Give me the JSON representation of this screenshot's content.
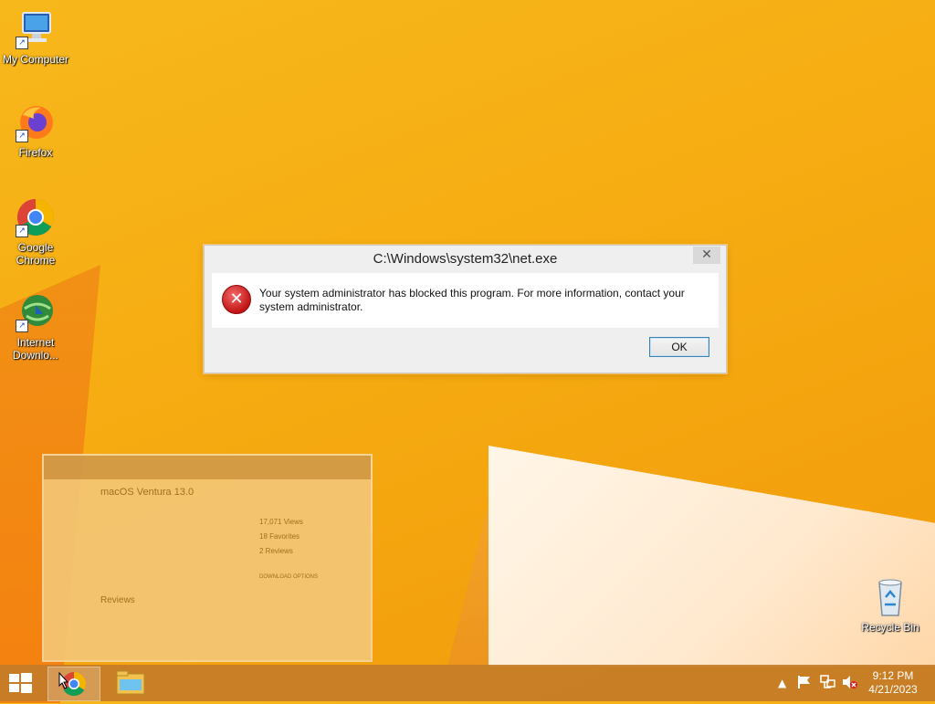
{
  "desktop": {
    "icons": [
      {
        "label": "My Computer"
      },
      {
        "label": "Firefox"
      },
      {
        "label": "Google Chrome"
      },
      {
        "label": "Internet Downlo..."
      },
      {
        "label": "Recycle Bin"
      }
    ]
  },
  "dialog": {
    "title": "C:\\Windows\\system32\\net.exe",
    "close_symbol": "✕",
    "message": "Your system administrator has blocked this program. For more information, contact your system administrator.",
    "ok_label": "OK",
    "icon": "error-icon"
  },
  "preview": {
    "title": "macOS Ventura 13.0",
    "views": "17,071 Views",
    "favorites": "18 Favorites",
    "reviews_count": "2 Reviews",
    "reviews_heading": "Reviews",
    "download_options": "DOWNLOAD OPTIONS"
  },
  "taskbar": {
    "time": "9:12 PM",
    "date": "4/21/2023",
    "tray_icons": [
      "chevron-up-icon",
      "flag-icon",
      "network-icon",
      "volume-muted-icon"
    ]
  }
}
